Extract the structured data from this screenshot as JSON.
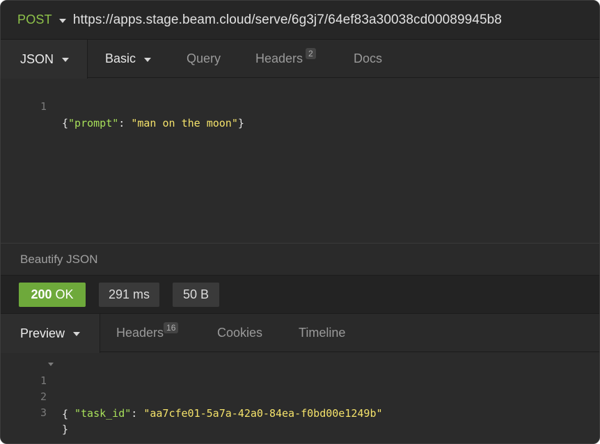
{
  "request": {
    "method": "POST",
    "url": "https://apps.stage.beam.cloud/serve/6g3j7/64ef83a30038cd00089945b8"
  },
  "request_tabs": [
    {
      "label": "JSON",
      "badge": ""
    },
    {
      "label": "Basic",
      "badge": ""
    },
    {
      "label": "Query",
      "badge": ""
    },
    {
      "label": "Headers",
      "badge": "2"
    },
    {
      "label": "Docs",
      "badge": ""
    }
  ],
  "request_body": {
    "line_number": "1",
    "open_brace": "{",
    "key": "\"prompt\"",
    "colon": ": ",
    "value": "\"man on the moon\"",
    "close_brace": "}"
  },
  "beautify_label": "Beautify JSON",
  "status": {
    "code": "200",
    "text": "OK",
    "time": "291 ms",
    "size": "50 B"
  },
  "response_tabs": [
    {
      "label": "Preview",
      "badge": ""
    },
    {
      "label": "Headers",
      "badge": "16"
    },
    {
      "label": "Cookies",
      "badge": ""
    },
    {
      "label": "Timeline",
      "badge": ""
    }
  ],
  "response_body": {
    "line_numbers": [
      "1",
      "2",
      "3"
    ],
    "open_brace": "{",
    "key": "\"task_id\"",
    "colon": ": ",
    "value": "\"aa7cfe01-5a7a-42a0-84ea-f0bd00e1249b\"",
    "close_brace": "}"
  },
  "colors": {
    "method": "#8fc34a",
    "status_ok": "#6ea93b",
    "json_key": "#a8e05a",
    "json_string": "#f5e36b",
    "background": "#2a2a2a"
  },
  "icons": [
    "chevron-down-icon",
    "fold-arrow-icon"
  ]
}
